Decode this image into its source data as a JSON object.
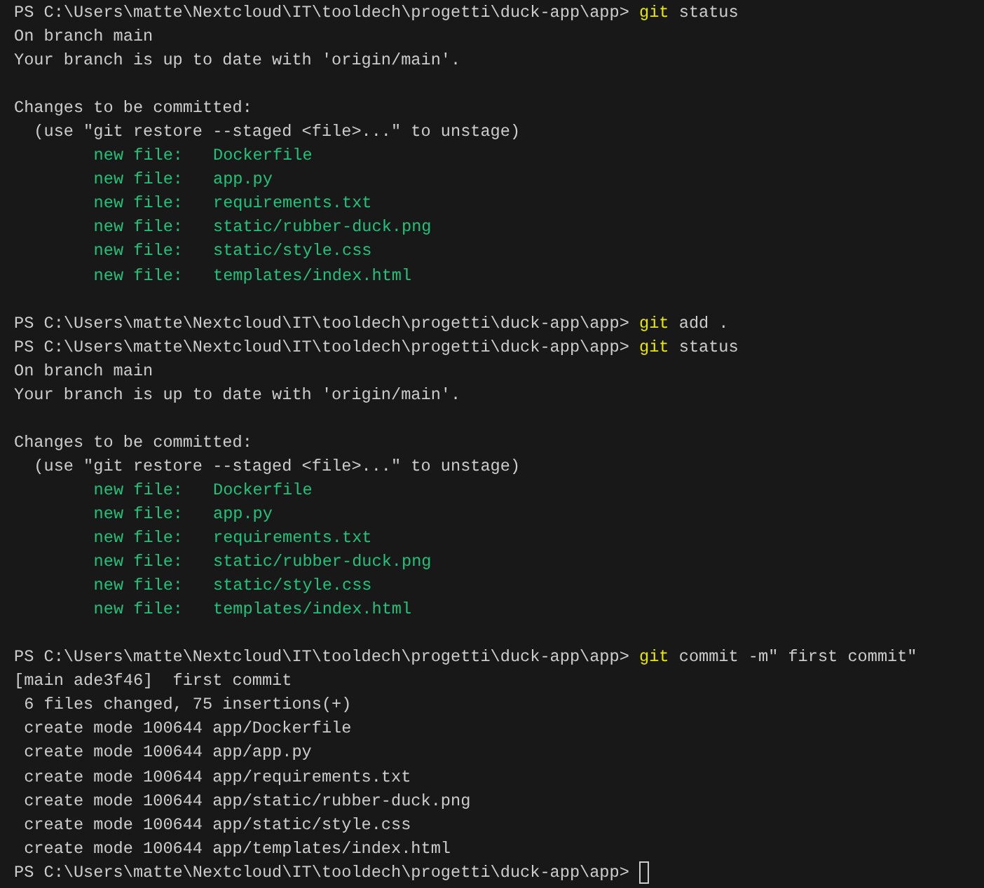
{
  "terminal": {
    "lines": [
      {
        "kind": "prompt",
        "prompt": "PS C:\\Users\\matte\\Nextcloud\\IT\\tooldech\\progetti\\duck-app\\app>",
        "command": "git",
        "args": "status",
        "cursor": false
      },
      {
        "kind": "text",
        "text": "On branch main"
      },
      {
        "kind": "text",
        "text": "Your branch is up to date with 'origin/main'."
      },
      {
        "kind": "blank"
      },
      {
        "kind": "text",
        "text": "Changes to be committed:"
      },
      {
        "kind": "text",
        "text": "  (use \"git restore --staged <file>...\" to unstage)"
      },
      {
        "kind": "staged",
        "label": "new file:",
        "path": "Dockerfile"
      },
      {
        "kind": "staged",
        "label": "new file:",
        "path": "app.py"
      },
      {
        "kind": "staged",
        "label": "new file:",
        "path": "requirements.txt"
      },
      {
        "kind": "staged",
        "label": "new file:",
        "path": "static/rubber-duck.png"
      },
      {
        "kind": "staged",
        "label": "new file:",
        "path": "static/style.css"
      },
      {
        "kind": "staged",
        "label": "new file:",
        "path": "templates/index.html"
      },
      {
        "kind": "blank"
      },
      {
        "kind": "prompt",
        "prompt": "PS C:\\Users\\matte\\Nextcloud\\IT\\tooldech\\progetti\\duck-app\\app>",
        "command": "git",
        "args": "add .",
        "cursor": false
      },
      {
        "kind": "prompt",
        "prompt": "PS C:\\Users\\matte\\Nextcloud\\IT\\tooldech\\progetti\\duck-app\\app>",
        "command": "git",
        "args": "status",
        "cursor": false
      },
      {
        "kind": "text",
        "text": "On branch main"
      },
      {
        "kind": "text",
        "text": "Your branch is up to date with 'origin/main'."
      },
      {
        "kind": "blank"
      },
      {
        "kind": "text",
        "text": "Changes to be committed:"
      },
      {
        "kind": "text",
        "text": "  (use \"git restore --staged <file>...\" to unstage)"
      },
      {
        "kind": "staged",
        "label": "new file:",
        "path": "Dockerfile"
      },
      {
        "kind": "staged",
        "label": "new file:",
        "path": "app.py"
      },
      {
        "kind": "staged",
        "label": "new file:",
        "path": "requirements.txt"
      },
      {
        "kind": "staged",
        "label": "new file:",
        "path": "static/rubber-duck.png"
      },
      {
        "kind": "staged",
        "label": "new file:",
        "path": "static/style.css"
      },
      {
        "kind": "staged",
        "label": "new file:",
        "path": "templates/index.html"
      },
      {
        "kind": "blank"
      },
      {
        "kind": "prompt",
        "prompt": "PS C:\\Users\\matte\\Nextcloud\\IT\\tooldech\\progetti\\duck-app\\app>",
        "command": "git",
        "args": "commit -m\" first commit\"",
        "cursor": false
      },
      {
        "kind": "text",
        "text": "[main ade3f46]  first commit"
      },
      {
        "kind": "text",
        "text": " 6 files changed, 75 insertions(+)"
      },
      {
        "kind": "text",
        "text": " create mode 100644 app/Dockerfile"
      },
      {
        "kind": "text",
        "text": " create mode 100644 app/app.py"
      },
      {
        "kind": "text",
        "text": " create mode 100644 app/requirements.txt"
      },
      {
        "kind": "text",
        "text": " create mode 100644 app/static/rubber-duck.png"
      },
      {
        "kind": "text",
        "text": " create mode 100644 app/static/style.css"
      },
      {
        "kind": "text",
        "text": " create mode 100644 app/templates/index.html"
      },
      {
        "kind": "prompt",
        "prompt": "PS C:\\Users\\matte\\Nextcloud\\IT\\tooldech\\progetti\\duck-app\\app>",
        "cursor": true
      }
    ]
  }
}
